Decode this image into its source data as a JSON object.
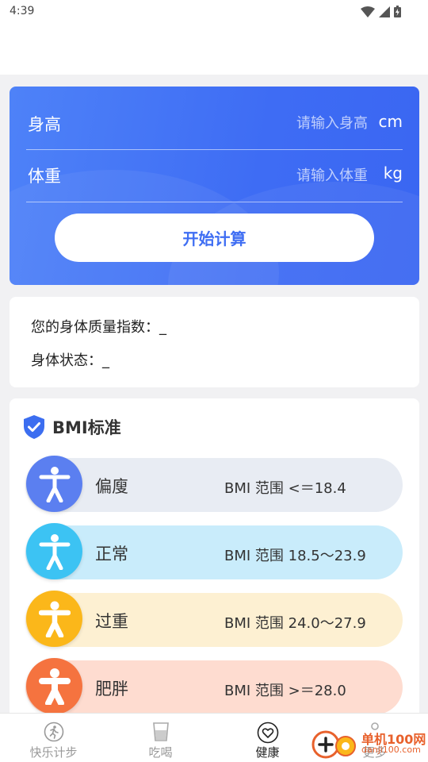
{
  "status_bar": {
    "time": "4:39"
  },
  "calculator": {
    "height_label": "身高",
    "height_placeholder": "请输入身高",
    "height_unit": "cm",
    "weight_label": "体重",
    "weight_placeholder": "请输入体重",
    "weight_unit": "kg",
    "calc_button": "开始计算"
  },
  "result": {
    "bmi_label": "您的身体质量指数：",
    "bmi_value": "_",
    "status_label": "身体状态：",
    "status_value": "_"
  },
  "standard": {
    "title": "BMI标准",
    "rows": [
      {
        "name": "偏廋",
        "range": "BMI 范围 <＝18.4",
        "bg": "#e8ecf3",
        "circle": "#5b7ff0"
      },
      {
        "name": "正常",
        "range": "BMI 范围 18.5～23.9",
        "bg": "#c9ecfb",
        "circle": "#3cc3f3"
      },
      {
        "name": "过重",
        "range": "BMI 范围 24.0～27.9",
        "bg": "#fdf0d2",
        "circle": "#fbb71a"
      },
      {
        "name": "肥胖",
        "range": "BMI 范围 >＝28.0",
        "bg": "#fedcd0",
        "circle": "#f5733f"
      }
    ]
  },
  "tabs": [
    {
      "label": "快乐计步",
      "icon": "running-icon",
      "active": false
    },
    {
      "label": "吃喝",
      "icon": "cup-icon",
      "active": false
    },
    {
      "label": "健康",
      "icon": "heart-icon",
      "active": true
    },
    {
      "label": "更多",
      "icon": "more-icon",
      "active": false
    }
  ],
  "watermark": {
    "text": "单机100网",
    "sub": "danji100.com"
  }
}
